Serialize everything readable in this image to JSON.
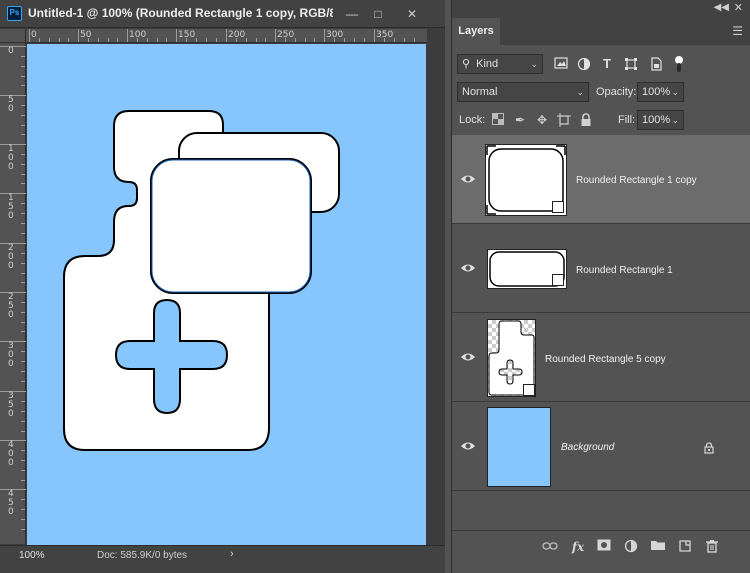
{
  "document": {
    "title": "Untitled-1 @ 100% (Rounded Rectangle 1 copy, RGB/8#...",
    "app_icon": "Ps",
    "canvas_color": "#86c6fc",
    "ruler_top_labels": [
      "0",
      "50",
      "100",
      "150",
      "200",
      "250",
      "300",
      "350"
    ],
    "ruler_left_labels": [
      "0",
      "5\n0",
      "1\n0\n0",
      "1\n5\n0",
      "2\n0\n0",
      "2\n5\n0",
      "3\n0\n0",
      "3\n5\n0",
      "4\n0\n0",
      "4\n5\n0"
    ],
    "window_controls": [
      "minimize-icon",
      "maximize-icon",
      "close-icon"
    ]
  },
  "status": {
    "zoom": "100%",
    "doc_info": "Doc: 585.9K/0 bytes",
    "arrow": "›"
  },
  "layers_panel": {
    "tab_label": "Layers",
    "filter": {
      "kind_label": "Kind"
    },
    "blend_mode": "Normal",
    "opacity_label": "Opacity:",
    "opacity_value": "100%",
    "lock_label": "Lock:",
    "fill_label": "Fill:",
    "fill_value": "100%",
    "layers": [
      {
        "name": "Rounded Rectangle 1 copy",
        "selected": true,
        "visible": true,
        "italic": false
      },
      {
        "name": "Rounded Rectangle 1",
        "selected": false,
        "visible": true,
        "italic": false
      },
      {
        "name": "Rounded Rectangle 5 copy",
        "selected": false,
        "visible": true,
        "italic": false
      },
      {
        "name": "Background",
        "selected": false,
        "visible": true,
        "italic": true,
        "locked": true
      }
    ],
    "bottom_icons": [
      "link-layers-icon",
      "fx-icon",
      "mask-icon",
      "adjustment-icon",
      "folder-icon",
      "new-layer-icon",
      "trash-icon"
    ]
  }
}
